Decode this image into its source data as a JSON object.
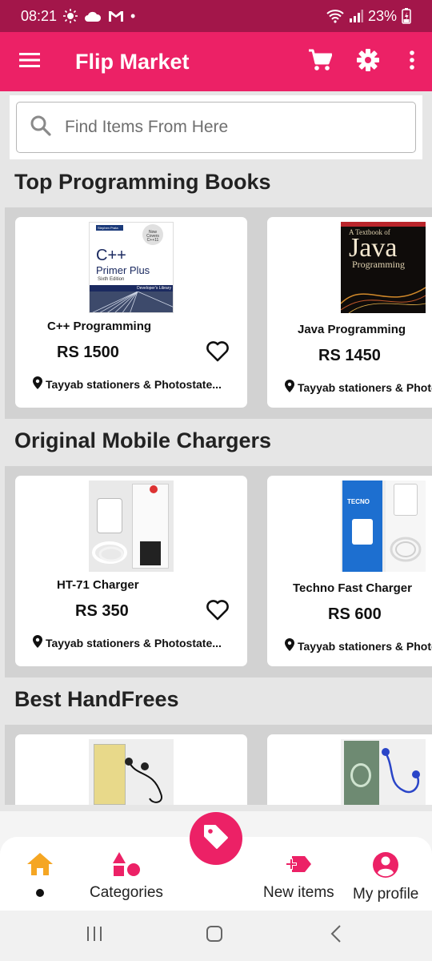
{
  "status_bar": {
    "time": "08:21",
    "dot": "•",
    "battery": "23%"
  },
  "app_bar": {
    "title": "Flip Market"
  },
  "search": {
    "placeholder": "Find Items From Here"
  },
  "sections": [
    {
      "title": "Top Programming Books",
      "products": [
        {
          "name": "C++ Programming",
          "price": "RS 1500",
          "location": "Tayyab stationers & Photostate...",
          "cover": {
            "title": "C++",
            "subtitle": "Primer Plus",
            "edition": "Sixth Edition",
            "series": "Developer's Library",
            "author": "Stephen Prata",
            "badge": "Now Covers C++11"
          }
        },
        {
          "name": "Java Programming",
          "price": "RS 1450",
          "location": "Tayyab stationers & Photostate...",
          "cover": {
            "top": "A Textbook of",
            "title": "Java",
            "subtitle": "Programming"
          }
        }
      ]
    },
    {
      "title": "Original Mobile Chargers",
      "products": [
        {
          "name": "HT-71 Charger",
          "price": "RS 350",
          "location": "Tayyab stationers & Photostate..."
        },
        {
          "name": "Techno Fast Charger",
          "price": "RS 600",
          "location": "Tayyab stationers & Photostate...",
          "box_brand": "TECNO"
        }
      ]
    },
    {
      "title": "Best HandFrees",
      "products": [
        {
          "name": ""
        },
        {
          "name": ""
        }
      ]
    }
  ],
  "bottom_nav": {
    "items": [
      {
        "label": "",
        "icon": "home-icon",
        "active": true
      },
      {
        "label": "Categories",
        "icon": "shapes-icon"
      },
      {
        "label": "New items",
        "icon": "new-tag-icon"
      },
      {
        "label": "My profile",
        "icon": "account-circle-icon"
      }
    ],
    "fab_icon": "tag-icon"
  },
  "colors": {
    "primary": "#ec2166",
    "status_bar": "#a3164a",
    "accent_orange": "#f5a623"
  }
}
